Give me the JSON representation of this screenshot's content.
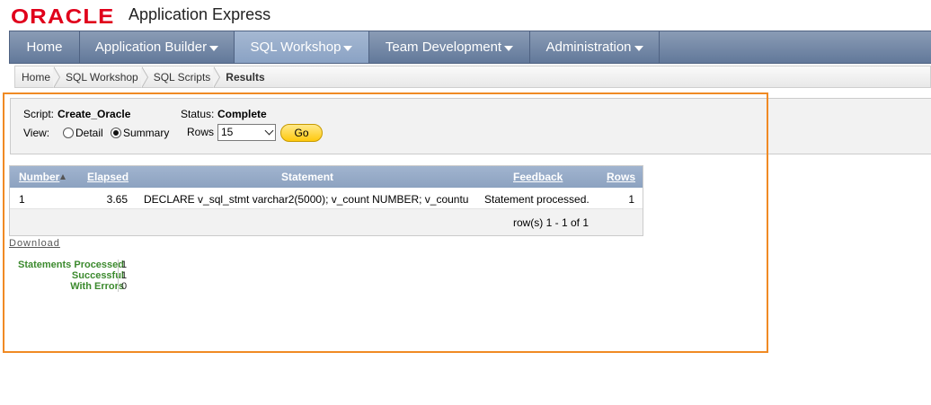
{
  "header": {
    "logo_text": "ORACLE",
    "app_name": "Application Express"
  },
  "nav": {
    "tabs": [
      {
        "label": "Home",
        "has_menu": false,
        "active": false
      },
      {
        "label": "Application Builder",
        "has_menu": true,
        "active": false
      },
      {
        "label": "SQL Workshop",
        "has_menu": true,
        "active": true
      },
      {
        "label": "Team Development",
        "has_menu": true,
        "active": false
      },
      {
        "label": "Administration",
        "has_menu": true,
        "active": false
      }
    ]
  },
  "breadcrumb": {
    "items": [
      "Home",
      "SQL Workshop",
      "SQL Scripts",
      "Results"
    ]
  },
  "script_panel": {
    "script_label": "Script:",
    "script_value": "Create_Oracle",
    "status_label": "Status:",
    "status_value": "Complete",
    "view_label": "View:",
    "view_options": [
      "Detail",
      "Summary"
    ],
    "view_selected": "Summary",
    "rows_label": "Rows",
    "rows_value": "15",
    "go_label": "Go"
  },
  "results": {
    "columns": [
      "Number",
      "Elapsed",
      "Statement",
      "Feedback",
      "Rows"
    ],
    "rows": [
      {
        "number": "1",
        "elapsed": "3.65",
        "statement": "DECLARE v_sql_stmt varchar2(5000); v_count NUMBER; v_countu",
        "feedback": "Statement processed.",
        "rows": "1"
      }
    ],
    "pager": "row(s) 1 - 1 of 1"
  },
  "download_label": "Download",
  "stats": [
    {
      "label": "Statements Processed",
      "value": "1"
    },
    {
      "label": "Successful",
      "value": "1"
    },
    {
      "label": "With Errors",
      "value": "0"
    }
  ],
  "colors": {
    "oracle_red": "#e0001b",
    "nav_blue": "#62789a",
    "highlight_orange": "#f08a24",
    "stat_green": "#3c8a2e"
  }
}
